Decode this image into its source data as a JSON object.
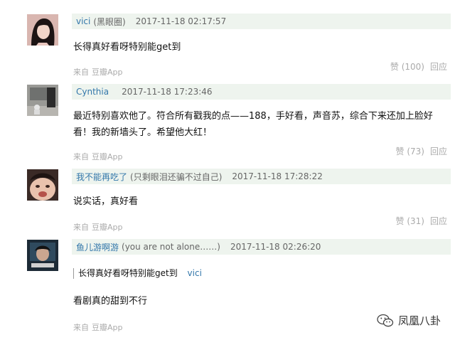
{
  "comments": [
    {
      "author": "vici",
      "author_note": "(黑眼圈)",
      "date": "2017-11-18 02:17:57",
      "text": "长得真好看呀特别能get到",
      "source_label": "来自",
      "source_app": "豆瓣App",
      "likes": "赞 (100)",
      "reply": "回应"
    },
    {
      "author": "Cynthia",
      "author_note": "",
      "date": "2017-11-18 17:23:46",
      "text": "最近特别喜欢他了。符合所有戳我的点——188，手好看，声音苏，综合下来还加上脸好看！我的新墙头了。希望他大红！",
      "source_label": "来自",
      "source_app": "豆瓣App",
      "likes": "赞 (73)",
      "reply": "回应"
    },
    {
      "author": "我不能再吃了",
      "author_note": "(只剩眼泪还骗不过自己)",
      "date": "2017-11-18 17:28:22",
      "text": "说实话，真好看",
      "source_label": "来自",
      "source_app": "豆瓣App",
      "likes": "赞 (31)",
      "reply": "回应"
    },
    {
      "author": "鱼儿游啊游",
      "author_note": "(you are not alone……)",
      "date": "2017-11-18 02:26:20",
      "quote_text": "长得真好看呀特别能get到",
      "quote_author": "vici",
      "text": "看剧真的甜到不行",
      "source_label": "来自",
      "source_app": "豆瓣App"
    }
  ],
  "watermark": {
    "text": "凤凰八卦",
    "icon": "wechat-icon"
  }
}
